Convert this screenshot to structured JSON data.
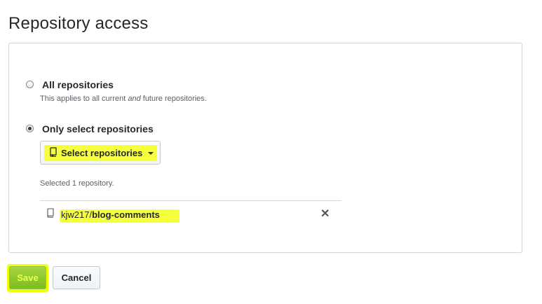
{
  "page": {
    "title": "Repository access"
  },
  "options": {
    "all": {
      "label": "All repositories",
      "note_prefix": "This applies to all current ",
      "note_em": "and",
      "note_suffix": " future repositories.",
      "checked": false
    },
    "select": {
      "label": "Only select repositories",
      "checked": true
    }
  },
  "select_button": {
    "label": "Select repositories",
    "icon": "repo-icon"
  },
  "selection": {
    "summary": "Selected 1 repository.",
    "repos": [
      {
        "owner": "kjw217",
        "separator": "/",
        "name": "blog-comments",
        "icon": "repo-icon",
        "remove_icon": "close-icon"
      }
    ]
  },
  "actions": {
    "save_label": "Save",
    "cancel_label": "Cancel"
  },
  "colors": {
    "highlight": "#f6ff3b",
    "save_green": "#7cbc1e",
    "border": "#d1d5da"
  }
}
